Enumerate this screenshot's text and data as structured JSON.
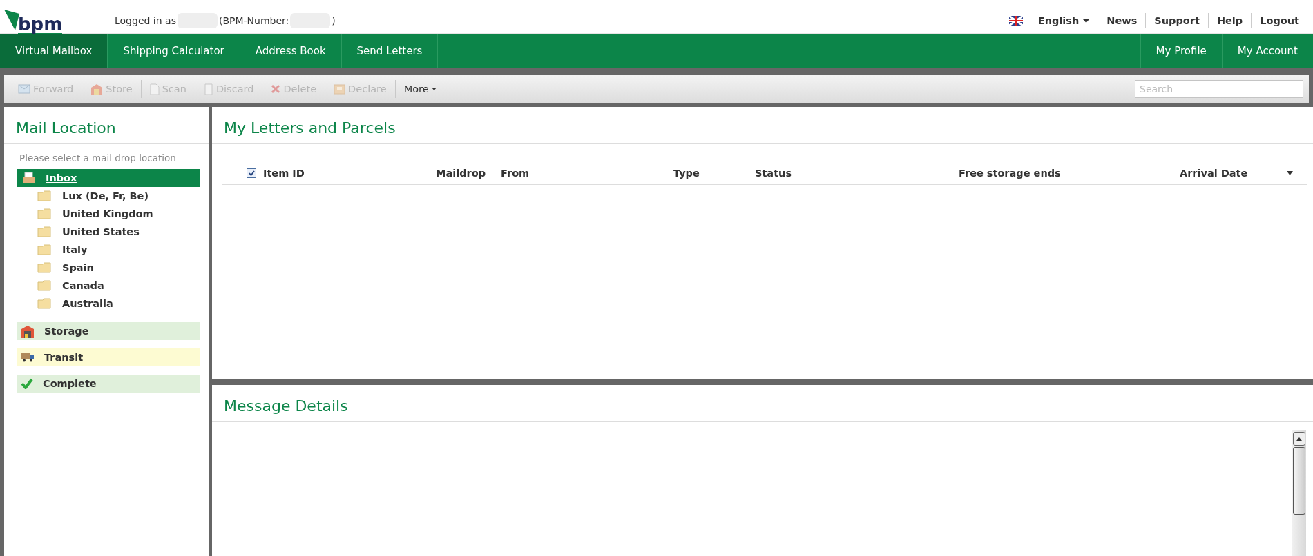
{
  "header": {
    "logo": "bpm",
    "login_prefix": "Logged in as",
    "number_prefix": "(BPM-Number:",
    "number_suffix": ")",
    "language": "English",
    "links": [
      "News",
      "Support",
      "Help",
      "Logout"
    ]
  },
  "nav": {
    "left": [
      {
        "label": "Virtual Mailbox",
        "selected": true
      },
      {
        "label": "Shipping Calculator",
        "selected": false
      },
      {
        "label": "Address Book",
        "selected": false
      },
      {
        "label": "Send Letters",
        "selected": false
      }
    ],
    "right": [
      {
        "label": "My Profile",
        "selected": false
      },
      {
        "label": "My Account",
        "selected": false
      }
    ]
  },
  "toolbar": {
    "buttons": [
      {
        "kind": "forward",
        "label": "Forward",
        "disabled": true
      },
      {
        "kind": "store",
        "label": "Store",
        "disabled": true
      },
      {
        "kind": "scan",
        "label": "Scan",
        "disabled": true
      },
      {
        "kind": "discard",
        "label": "Discard",
        "disabled": true
      },
      {
        "kind": "delete",
        "label": "Delete",
        "disabled": true
      },
      {
        "kind": "declare",
        "label": "Declare",
        "disabled": true
      }
    ],
    "more": "More",
    "search": {
      "placeholder": "Search"
    }
  },
  "sidebar": {
    "title": "Mail Location",
    "hint": "Please select a mail drop location",
    "inbox": {
      "label": "Inbox",
      "selected": true,
      "children": [
        {
          "label": "Lux (De, Fr, Be)"
        },
        {
          "label": "United Kingdom"
        },
        {
          "label": "United States"
        },
        {
          "label": "Italy"
        },
        {
          "label": "Spain"
        },
        {
          "label": "Canada"
        },
        {
          "label": "Australia"
        }
      ]
    },
    "statuses": [
      {
        "kind": "storage",
        "label": "Storage",
        "color": "#e0f0db"
      },
      {
        "kind": "transit",
        "label": "Transit",
        "color": "#fdfbd2"
      },
      {
        "kind": "complete",
        "label": "Complete",
        "color": "#e0f0db"
      }
    ]
  },
  "letters": {
    "title": "My Letters and Parcels",
    "select_all": {
      "checked": true
    },
    "columns": [
      "Item ID",
      "Maildrop",
      "From",
      "Type",
      "Status",
      "Free storage ends",
      "Arrival Date"
    ],
    "sort_descending": true
  },
  "details": {
    "title": "Message Details"
  }
}
